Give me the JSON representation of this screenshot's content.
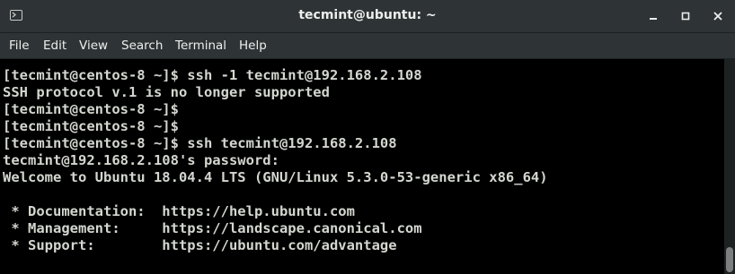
{
  "window": {
    "title": "tecmint@ubuntu: ~"
  },
  "icons": {
    "app": "terminal-icon",
    "minimize": "minimize-icon",
    "maximize": "maximize-icon",
    "close": "close-icon"
  },
  "menu": {
    "items": [
      "File",
      "Edit",
      "View",
      "Search",
      "Terminal",
      "Help"
    ]
  },
  "terminal": {
    "lines": [
      "[tecmint@centos-8 ~]$ ssh -1 tecmint@192.168.2.108",
      "SSH protocol v.1 is no longer supported",
      "[tecmint@centos-8 ~]$",
      "[tecmint@centos-8 ~]$",
      "[tecmint@centos-8 ~]$ ssh tecmint@192.168.2.108",
      "tecmint@192.168.2.108's password:",
      "Welcome to Ubuntu 18.04.4 LTS (GNU/Linux 5.3.0-53-generic x86_64)",
      "",
      " * Documentation:  https://help.ubuntu.com",
      " * Management:     https://landscape.canonical.com",
      " * Support:        https://ubuntu.com/advantage"
    ]
  },
  "colors": {
    "titlebar_bg": "#2e3436",
    "terminal_bg": "#000000",
    "terminal_fg": "#d3d7cf",
    "title_fg": "#eeeeec"
  }
}
